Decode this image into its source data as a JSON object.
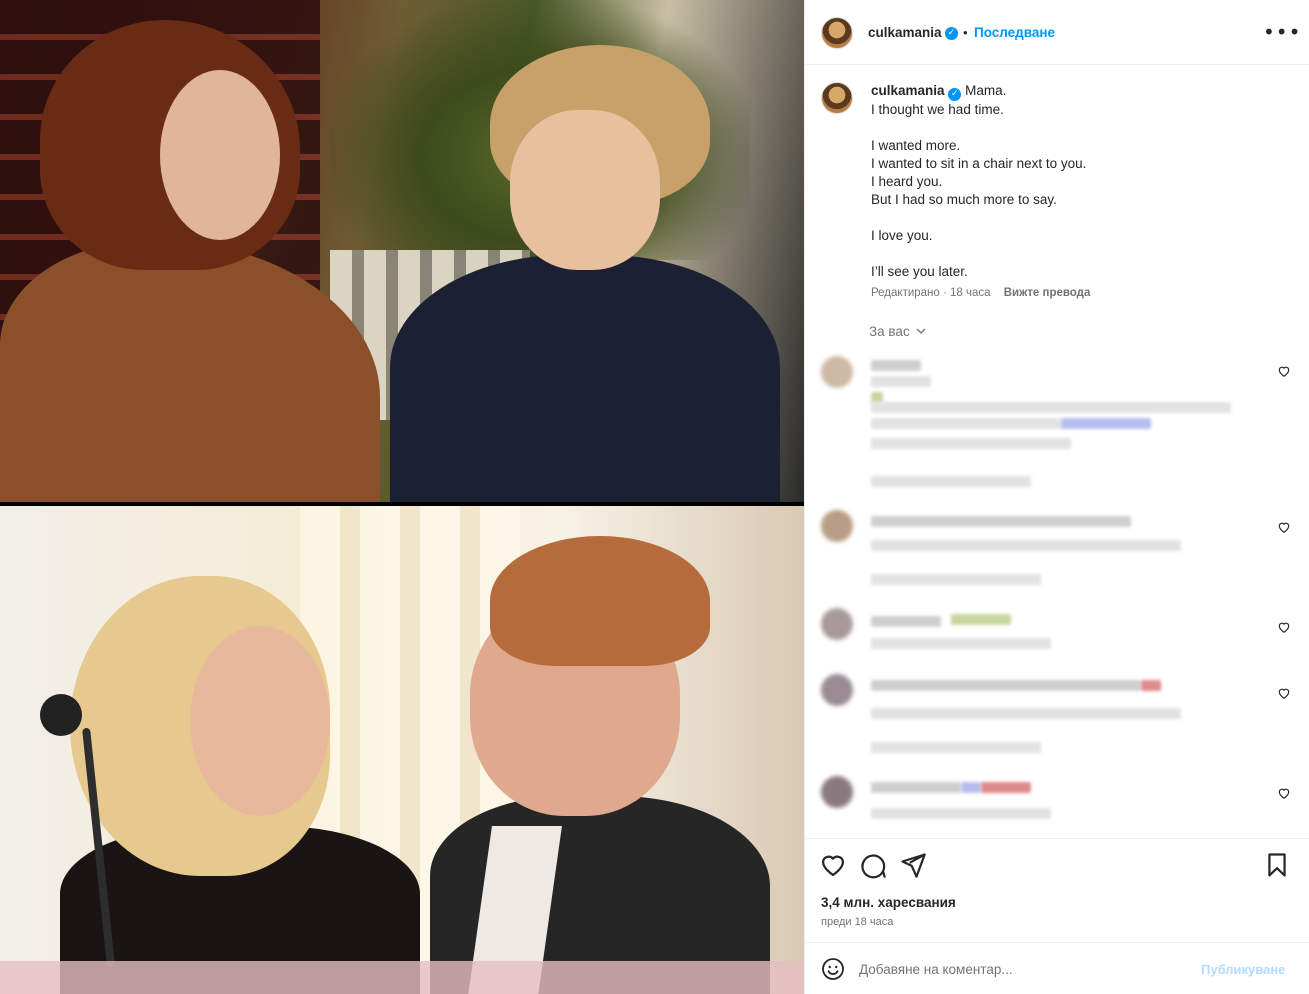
{
  "post": {
    "username": "culkamania",
    "separator": "•",
    "follow_label": "Последване",
    "more_label": "•••",
    "caption_lines": [
      "Mama.",
      "I thought we had time.",
      "",
      "I wanted more.",
      "I wanted to sit in a chair next to you.",
      "I heard you.",
      "But I had so much more to say.",
      "",
      "I love you.",
      "",
      "I’ll see you later."
    ],
    "edited_label": "Редактирано · 18 часа",
    "translate_label": "Вижте превода",
    "for_you_label": "За вас"
  },
  "engagement": {
    "likes": "3,4 млн. харесвания",
    "posted_ago": "преди 18 часа"
  },
  "comment_box": {
    "placeholder": "Добавяне на коментар...",
    "publish_label": "Публикуване"
  },
  "icons": {
    "verified": "verified-badge-icon",
    "like": "heart-icon",
    "comment": "comment-icon",
    "share": "paper-plane-icon",
    "save": "bookmark-icon",
    "emoji": "smiley-icon"
  },
  "colors": {
    "accent": "#0095f6",
    "publish_disabled": "#b3dbff",
    "secondary_text": "#737373"
  }
}
